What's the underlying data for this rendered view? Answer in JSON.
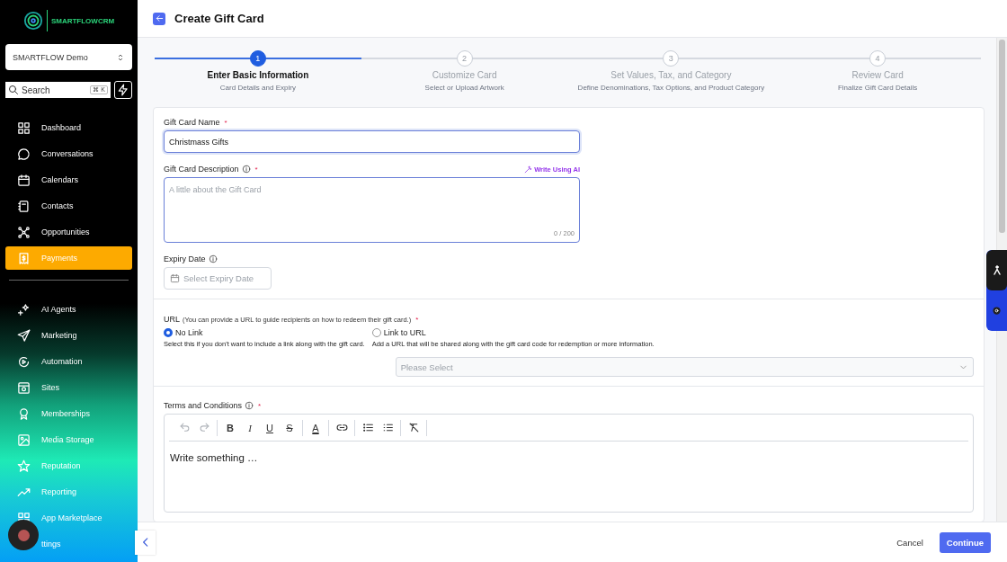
{
  "sidebar": {
    "logo": "SMARTFLOWCRM",
    "account": "SMARTFLOW Demo",
    "search": {
      "placeholder": "Search",
      "shortcut": "⌘ K"
    },
    "items": [
      {
        "label": "Dashboard",
        "selected": false
      },
      {
        "label": "Conversations",
        "selected": false
      },
      {
        "label": "Calendars",
        "selected": false
      },
      {
        "label": "Contacts",
        "selected": false
      },
      {
        "label": "Opportunities",
        "selected": false
      },
      {
        "label": "Payments",
        "selected": true
      }
    ],
    "items_secondary": [
      {
        "label": "AI Agents",
        "selected": false
      },
      {
        "label": "Marketing",
        "selected": false
      },
      {
        "label": "Automation",
        "selected": false
      },
      {
        "label": "Sites",
        "selected": false
      },
      {
        "label": "Memberships",
        "selected": false
      },
      {
        "label": "Media Storage",
        "selected": false
      },
      {
        "label": "Reputation",
        "selected": false
      },
      {
        "label": "Reporting",
        "selected": false
      },
      {
        "label": "App Marketplace",
        "selected": false
      },
      {
        "label": "ttings",
        "selected": false
      }
    ]
  },
  "header": {
    "title": "Create Gift Card"
  },
  "steps": [
    {
      "number": "1",
      "title": "Enter Basic Information",
      "subtitle": "Card Details and Expiry",
      "selected": true
    },
    {
      "number": "2",
      "title": "Customize Card",
      "subtitle": "Select or Upload Artwork",
      "selected": false
    },
    {
      "number": "3",
      "title": "Set Values, Tax, and Category",
      "subtitle": "Define Denominations, Tax Options, and Product Category",
      "selected": false
    },
    {
      "number": "4",
      "title": "Review Card",
      "subtitle": "Finalize Gift Card Details",
      "selected": false
    }
  ],
  "form": {
    "name": {
      "label": "Gift Card Name",
      "required_mark": "*",
      "value": "Christmass Gifts"
    },
    "description": {
      "label": "Gift Card Description",
      "required_mark": "*",
      "ai_action": "Write Using AI",
      "placeholder": "A little about the Gift Card",
      "counter": "0 / 200"
    },
    "expiry": {
      "label": "Expiry Date",
      "placeholder": "Select Expiry Date"
    },
    "url": {
      "label": "URL",
      "hint": "(You can provide a URL to guide recipients on how to redeem their gift card.)",
      "required_mark": "*",
      "options": [
        {
          "label": "No Link",
          "description": "Select this if you don't want to include a link along with the gift card.",
          "selected": true
        },
        {
          "label": "Link to URL",
          "description": "Add a URL that will be shared along with the gift card code for redemption or more information.",
          "selected": false
        }
      ],
      "select": {
        "placeholder": "Please Select"
      }
    },
    "terms": {
      "label": "Terms and Conditions",
      "required_mark": "*",
      "placeholder": "Write something …",
      "toolbar": [
        {
          "kind": "undo",
          "disabled": true
        },
        {
          "kind": "redo",
          "disabled": true
        },
        {
          "kind": "divider"
        },
        {
          "kind": "bold",
          "glyph": "B"
        },
        {
          "kind": "italic",
          "glyph": "I"
        },
        {
          "kind": "underline",
          "glyph": "U"
        },
        {
          "kind": "strike",
          "glyph": "S"
        },
        {
          "kind": "divider"
        },
        {
          "kind": "color",
          "glyph": "A"
        },
        {
          "kind": "divider"
        },
        {
          "kind": "link"
        },
        {
          "kind": "divider"
        },
        {
          "kind": "bullets"
        },
        {
          "kind": "numbers"
        },
        {
          "kind": "divider"
        },
        {
          "kind": "clear"
        },
        {
          "kind": "divider"
        }
      ]
    }
  },
  "footer": {
    "cancel": "Cancel",
    "continue": "Continue"
  }
}
